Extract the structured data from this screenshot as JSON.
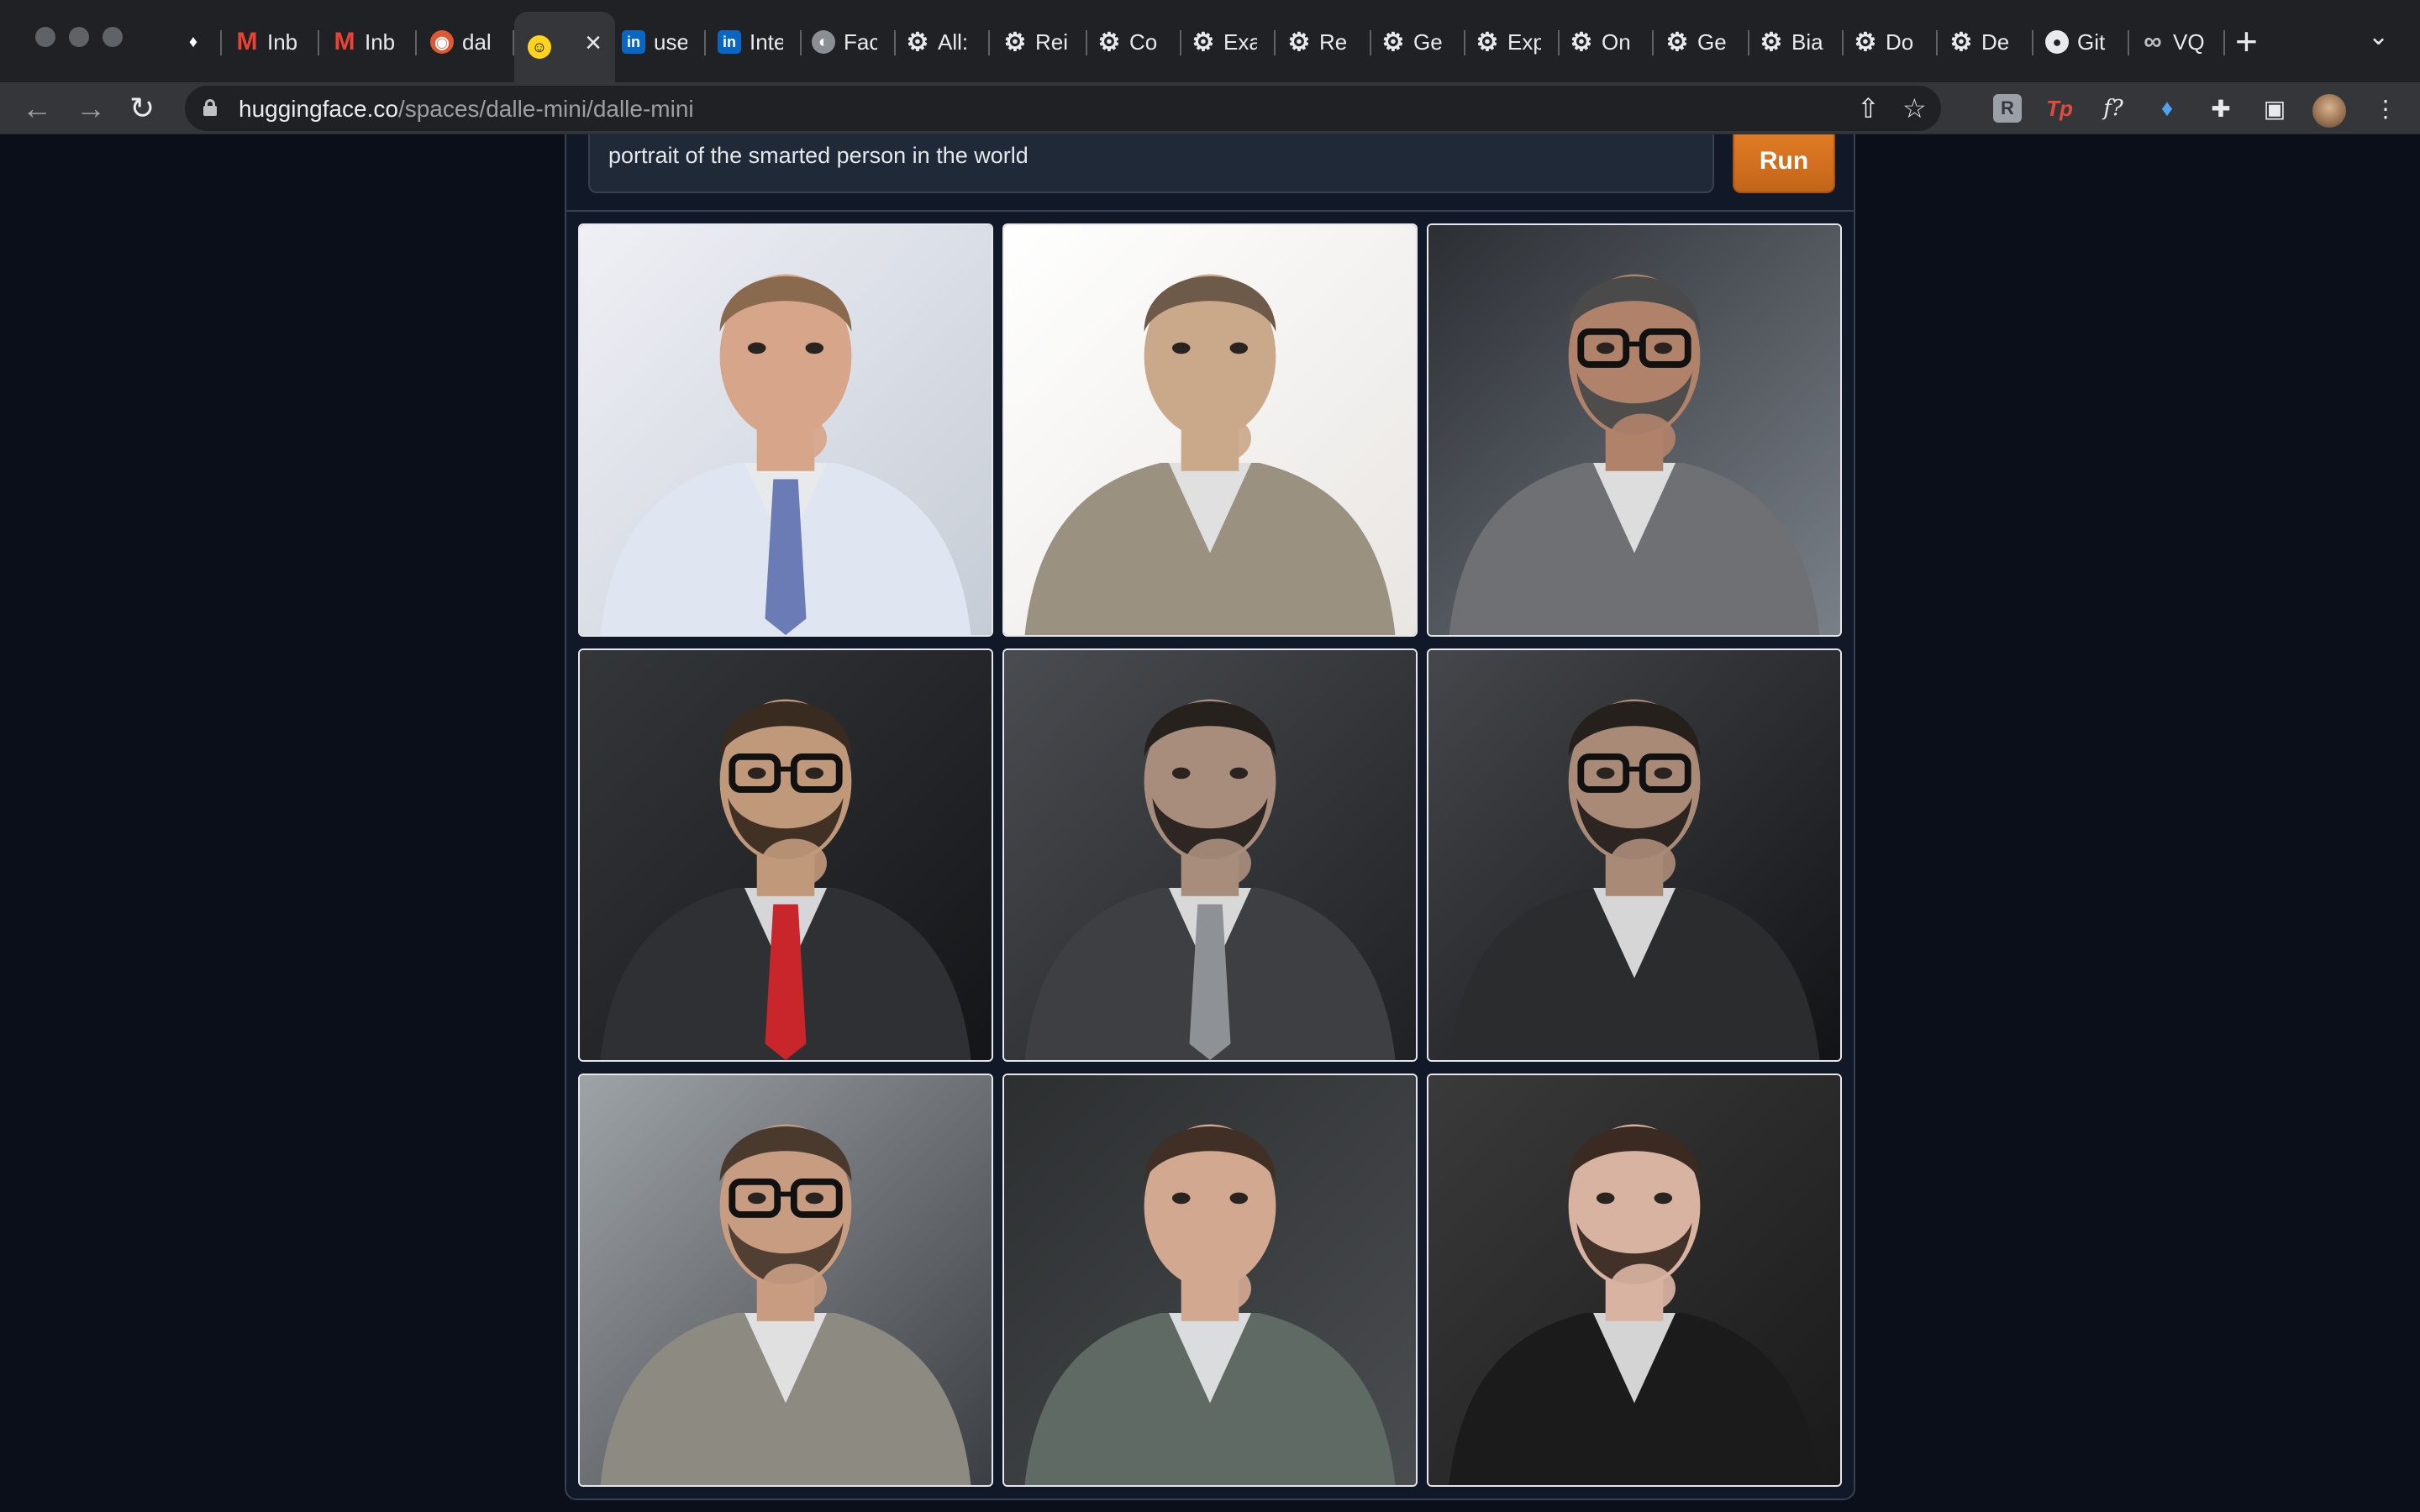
{
  "browser": {
    "tabs": [
      {
        "favicon": "gem-icon",
        "title": ""
      },
      {
        "favicon": "gmail-icon",
        "title": "Inb"
      },
      {
        "favicon": "gmail-icon",
        "title": "Inb"
      },
      {
        "favicon": "duckduckgo-icon",
        "title": "dal"
      },
      {
        "favicon": "huggingface-icon",
        "title": "",
        "active": true
      },
      {
        "favicon": "linkedin-icon",
        "title": "use"
      },
      {
        "favicon": "linkedin-icon",
        "title": "Inte"
      },
      {
        "favicon": "globe-icon",
        "title": "Fac"
      },
      {
        "favicon": "gear-icon",
        "title": "All:"
      },
      {
        "favicon": "gear-icon",
        "title": "Rei"
      },
      {
        "favicon": "gear-icon",
        "title": "Co"
      },
      {
        "favicon": "gear-icon",
        "title": "Exa"
      },
      {
        "favicon": "gear-icon",
        "title": "Re"
      },
      {
        "favicon": "gear-icon",
        "title": "Ge"
      },
      {
        "favicon": "gear-icon",
        "title": "Exp"
      },
      {
        "favicon": "gear-icon",
        "title": "On"
      },
      {
        "favicon": "gear-icon",
        "title": "Ge"
      },
      {
        "favicon": "gear-icon",
        "title": "Bia"
      },
      {
        "favicon": "gear-icon",
        "title": "Do"
      },
      {
        "favicon": "gear-icon",
        "title": "De"
      },
      {
        "favicon": "github-icon",
        "title": "Git"
      },
      {
        "favicon": "infinity-icon",
        "title": "VQ"
      }
    ],
    "url_host": "huggingface.co",
    "url_path": "/spaces/dalle-mini/dalle-mini",
    "extensions": [
      "r-extension-icon",
      "tp-extension-icon",
      "formula-extension-icon",
      "gem-extension-icon",
      "puzzle-icon",
      "side-panel-icon"
    ]
  },
  "app": {
    "prompt_value": "portrait of the smarted person in the world",
    "run_label": "Run",
    "images": [
      {
        "alt": "generated-portrait-1",
        "bg": [
          "#eef0f5",
          "#c6ccd6"
        ],
        "skin": "#d6a58a",
        "hair": "#8a6a4e",
        "suit": "#dfe5f1",
        "tie": "#6b7bb5",
        "glasses": false,
        "beard": false
      },
      {
        "alt": "generated-portrait-2",
        "bg": [
          "#ffffff",
          "#e9e6e2"
        ],
        "skin": "#caa88a",
        "hair": "#6d5a48",
        "suit": "#9b9180",
        "tie": "",
        "glasses": false,
        "beard": false
      },
      {
        "alt": "generated-portrait-3",
        "bg": [
          "#2b2f34",
          "#7a8088"
        ],
        "skin": "#b0826a",
        "hair": "#4a4a4a",
        "suit": "#6f7073",
        "tie": "",
        "glasses": true,
        "beard": true
      },
      {
        "alt": "generated-portrait-4",
        "bg": [
          "#34373a",
          "#141517"
        ],
        "skin": "#c0987a",
        "hair": "#3a2b20",
        "suit": "#2f3033",
        "tie": "#c8262a",
        "glasses": true,
        "beard": true
      },
      {
        "alt": "generated-portrait-5",
        "bg": [
          "#494c50",
          "#1f2124"
        ],
        "skin": "#a88d7c",
        "hair": "#27211d",
        "suit": "#3d3f42",
        "tie": "#8e9195",
        "glasses": false,
        "beard": true
      },
      {
        "alt": "generated-portrait-6",
        "bg": [
          "#44474b",
          "#121315"
        ],
        "skin": "#a98a76",
        "hair": "#25201c",
        "suit": "#2b2c2e",
        "tie": "",
        "glasses": true,
        "beard": true
      },
      {
        "alt": "generated-portrait-7",
        "bg": [
          "#9ea3a8",
          "#3b3e42"
        ],
        "skin": "#c79c80",
        "hair": "#4a3a2d",
        "suit": "#8d8a82",
        "tie": "",
        "glasses": true,
        "beard": true
      },
      {
        "alt": "generated-portrait-8",
        "bg": [
          "#2c2f30",
          "#4a4d4f"
        ],
        "skin": "#d2a891",
        "hair": "#3f2f24",
        "suit": "#606a64",
        "tie": "",
        "glasses": false,
        "beard": false
      },
      {
        "alt": "generated-portrait-9",
        "bg": [
          "#3a3a3a",
          "#1a1a1a"
        ],
        "skin": "#d9b3a2",
        "hair": "#3a2a22",
        "suit": "#1b1b1c",
        "tie": "",
        "glasses": false,
        "beard": true
      }
    ]
  }
}
